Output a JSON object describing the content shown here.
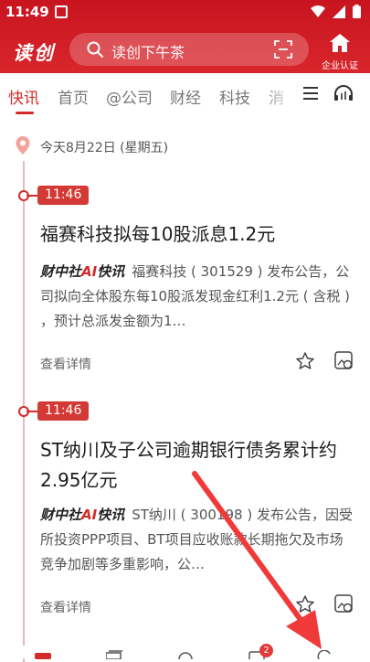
{
  "status": {
    "time": "11:49"
  },
  "header": {
    "logo": "读创",
    "search_placeholder": "读创下午茶",
    "enterprise_label": "企业认证"
  },
  "tabs": [
    {
      "label": "快讯",
      "active": true
    },
    {
      "label": "首页"
    },
    {
      "label": "@公司"
    },
    {
      "label": "财经"
    },
    {
      "label": "科技"
    },
    {
      "label": "消"
    }
  ],
  "feed": {
    "date": "今天8月22日 (星期五)",
    "items": [
      {
        "time": "11:46",
        "title": "福赛科技拟每10股派息1.2元",
        "source_a": "财中社",
        "source_b": "AI",
        "source_c": "快讯",
        "body": "福赛科技 ( 301529 ) 发布公告，公司拟向全体股东每10股派发现金红利1.2元 ( 含税 ) ，预计总派发金额为1…",
        "detail_label": "查看详情"
      },
      {
        "time": "11:46",
        "title": "ST纳川及子公司逾期银行债务累计约2.95亿元",
        "source_a": "财中社",
        "source_b": "AI",
        "source_c": "快讯",
        "body": "ST纳川 ( 300198 ) 发布公告，因受所投资PPP项目、BT项目应收账款长期拖欠及市场竞争加剧等多重影响，公…",
        "detail_label": "查看详情"
      }
    ]
  },
  "bottom_nav": {
    "badge": "2"
  },
  "colors": {
    "brand": "#d42a2a",
    "annotation_arrow": "#f03a3a"
  }
}
